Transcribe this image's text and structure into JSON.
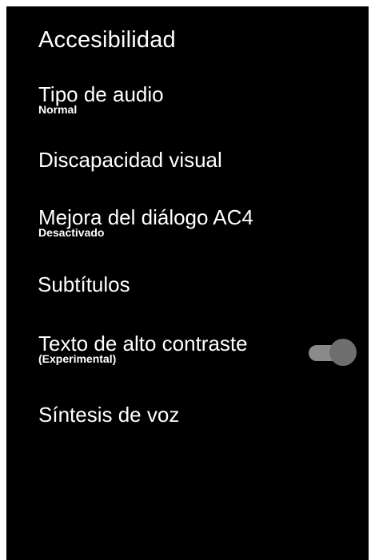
{
  "header": {
    "title": "Accesibilidad"
  },
  "menu": {
    "items": [
      {
        "label": "Tipo de audio",
        "sub": "Normal"
      },
      {
        "label": "Discapacidad visual",
        "sub": ""
      },
      {
        "label": "Mejora del diálogo AC4",
        "sub": "Desactivado"
      },
      {
        "label": "Subtítulos",
        "sub": ""
      },
      {
        "label": "Texto de alto contraste",
        "sub": "(Experimental)",
        "toggle_on": false
      },
      {
        "label": "Síntesis de voz",
        "sub": ""
      }
    ]
  },
  "colors": {
    "background": "#000000",
    "text": "#ffffff",
    "toggle_track": "#8a8a8a",
    "toggle_thumb": "#6e6e6e"
  }
}
